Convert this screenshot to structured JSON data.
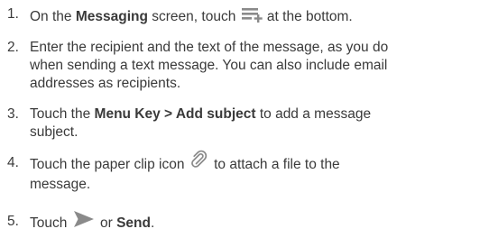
{
  "steps": [
    {
      "number": "1.",
      "part1": "On the ",
      "bold1": "Messaging",
      "part2": " screen, touch ",
      "icon": "new-message-icon",
      "part3": " at the bottom."
    },
    {
      "number": "2.",
      "line1": "Enter the recipient and the text of the message, as you do",
      "line2": "when sending a text message. You can also include email",
      "line3": "addresses as recipients."
    },
    {
      "number": "3.",
      "part1": "Touch the ",
      "bold1": "Menu Key > Add subject",
      "part2": " to add a message",
      "line2": "subject."
    },
    {
      "number": "4.",
      "part1": "Touch the paper clip icon ",
      "icon": "paper-clip-icon",
      "part2": " to attach a file to the",
      "line2": "message."
    },
    {
      "number": "5.",
      "part1": "Touch ",
      "icon": "send-arrow-icon",
      "part2": " or ",
      "bold1": "Send",
      "part3": "."
    }
  ],
  "colors": {
    "text": "#3a3a3a",
    "icon": "#8a8a8a"
  }
}
